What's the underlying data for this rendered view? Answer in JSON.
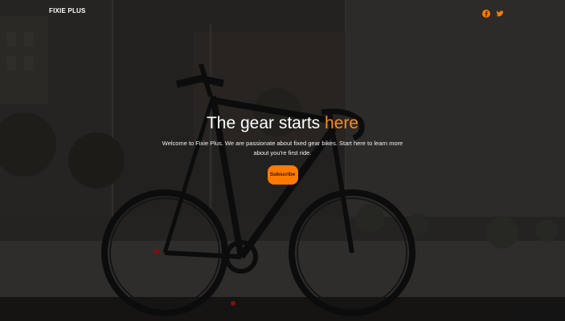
{
  "navbar": {
    "brand": "FIXIE PLUS",
    "social": [
      {
        "icon": "facebook-icon",
        "color": "#ff7a00"
      },
      {
        "icon": "twitter-icon",
        "color": "#ff7a00"
      }
    ]
  },
  "hero": {
    "headline_main": "The gear starts ",
    "headline_accent": "here",
    "tagline_line1": "Welcome to Fixie Plus. We are passionate about fixed gear bikes. Start here to learn more",
    "tagline_line2": "about you're first ride.",
    "cta_label": "Subscribe"
  },
  "colors": {
    "accent": "#ff7a00",
    "headline_accent": "#ff8a1e",
    "text": "#ffffff"
  }
}
